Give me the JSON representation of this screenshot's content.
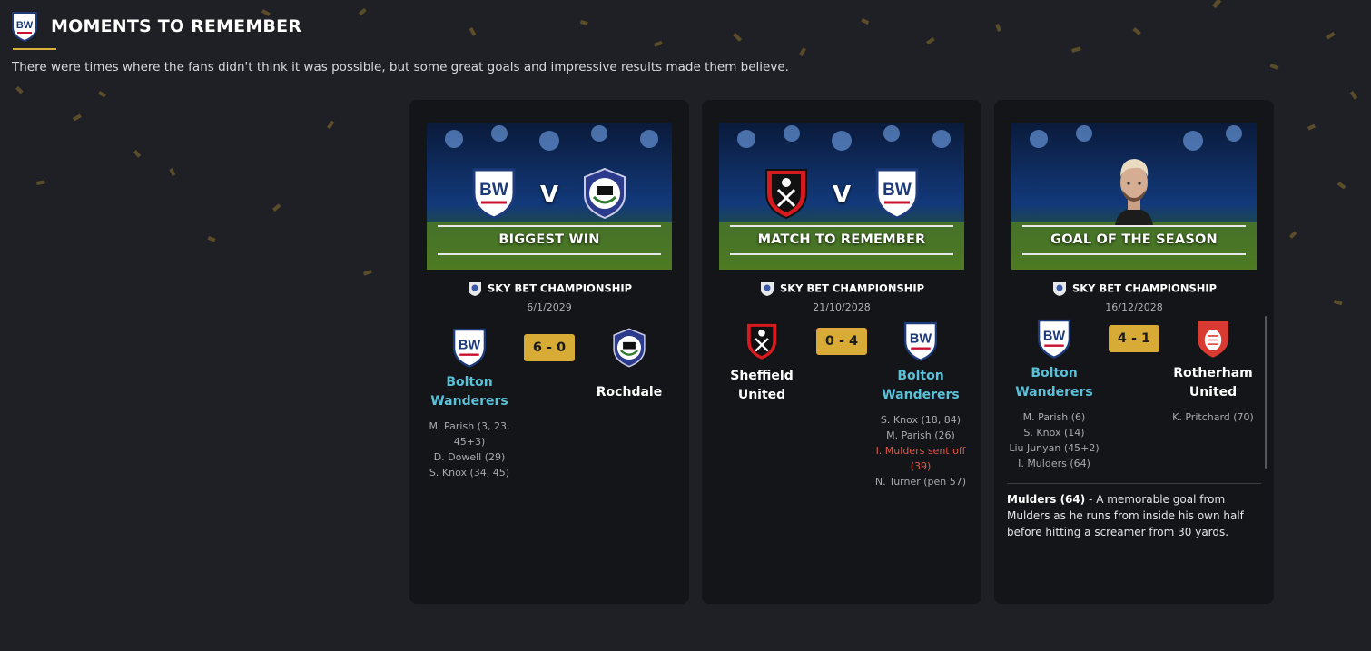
{
  "page": {
    "title": "MOMENTS TO REMEMBER",
    "subtitle": "There were times where the fans didn't think it was possible, but some great goals and impressive results made them believe."
  },
  "colors": {
    "background": "#1f2025",
    "card": "#141518",
    "accent_gold": "#d7ab35",
    "team_link": "#5bc1d8",
    "red_card_text": "#e2564d"
  },
  "cards": [
    {
      "label": "BIGGEST WIN",
      "vs": "V",
      "competition": "SKY BET CHAMPIONSHIP",
      "date": "6/1/2029",
      "score": "6 - 0",
      "home": {
        "name": "Bolton Wanderers",
        "icon": "bolton-crest-icon",
        "scorers": [
          "M. Parish (3, 23, 45+3)",
          "D. Dowell (29)",
          "S. Knox (34, 45)"
        ]
      },
      "away": {
        "name": "Rochdale",
        "icon": "rochdale-crest-icon",
        "scorers": []
      }
    },
    {
      "label": "MATCH TO REMEMBER",
      "vs": "V",
      "competition": "SKY BET CHAMPIONSHIP",
      "date": "21/10/2028",
      "score": "0 - 4",
      "home": {
        "name": "Sheffield United",
        "icon": "sheffield-united-crest-icon",
        "scorers": []
      },
      "away": {
        "name": "Bolton Wanderers",
        "icon": "bolton-crest-icon",
        "scorers": [
          "S. Knox (18, 84)",
          "M. Parish (26)"
        ],
        "red_card": "I. Mulders sent off (39)",
        "scorers_after": [
          "N. Turner (pen 57)"
        ]
      }
    },
    {
      "label": "GOAL OF THE SEASON",
      "competition": "SKY BET CHAMPIONSHIP",
      "date": "16/12/2028",
      "score": "4 - 1",
      "home": {
        "name": "Bolton Wanderers",
        "icon": "bolton-crest-icon",
        "scorers": [
          "M. Parish (6)",
          "S. Knox (14)",
          "Liu Junyan (45+2)",
          "I. Mulders (64)"
        ]
      },
      "away": {
        "name": "Rotherham United",
        "icon": "rotherham-crest-icon",
        "scorers": [
          "K. Pritchard (70)"
        ]
      },
      "goal": {
        "scorer": "Mulders (64)",
        "description": " - A memorable goal from Mulders as he runs from inside his own half before hitting a screamer from 30 yards."
      }
    }
  ]
}
